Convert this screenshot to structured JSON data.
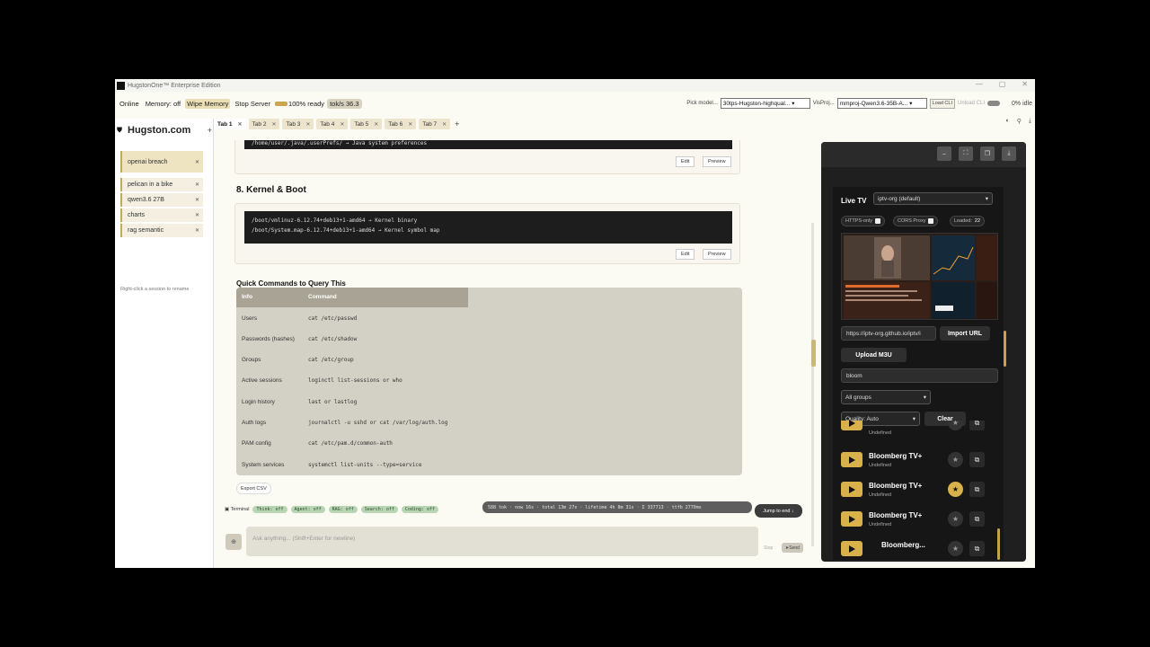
{
  "window": {
    "title": "HugstonOne™ Enterprise Edition",
    "controls": [
      "—",
      "▢",
      "✕"
    ]
  },
  "toolbar": {
    "online": "Online",
    "memory": "Memory: off",
    "wipe_memory": "Wipe Memory",
    "stop_server": "Stop Server",
    "ready": "100% ready",
    "toks": "tok/s 36.3",
    "pick_model_label": "Pick model...",
    "model_value": "30tps-Hugston-highqual...",
    "vis_proj_label": "VisProj...",
    "mmproj_value": "mmproj-Qwen3.6-35B-A...",
    "load_cli": "Load CLI",
    "unload_cli": "Unload CLI",
    "idle": "0% idle"
  },
  "tabs": [
    {
      "label": "Tab 1",
      "active": true
    },
    {
      "label": "Tab 2"
    },
    {
      "label": "Tab 3"
    },
    {
      "label": "Tab 4"
    },
    {
      "label": "Tab 5"
    },
    {
      "label": "Tab 6"
    },
    {
      "label": "Tab 7"
    }
  ],
  "sidebar": {
    "brand": "Hugston.com",
    "sessions": [
      {
        "label": "openai breach"
      },
      {
        "label": "pelican in a bike"
      },
      {
        "label": "qwen3.6 27B"
      },
      {
        "label": "charts"
      },
      {
        "label": "rag semantic"
      }
    ],
    "hint": "Right-click a session to rename"
  },
  "main": {
    "top_code": "/home/user/.java/.userPrefs/    →  Java system preferences",
    "edit": "Edit",
    "preview": "Preview",
    "section_title": "8. Kernel & Boot",
    "kernel_code": [
      "/boot/vmlinuz-6.12.74+deb13+1-amd64  → Kernel binary",
      "/boot/System.map-6.12.74+deb13+1-amd64 → Kernel symbol map"
    ],
    "quick_title": "Quick Commands to Query This",
    "table": {
      "headers": [
        "Info",
        "Command"
      ],
      "rows": [
        [
          "Users",
          "cat /etc/passwd"
        ],
        [
          "Passwords (hashes)",
          "cat /etc/shadow"
        ],
        [
          "Groups",
          "cat /etc/group"
        ],
        [
          "Active sessions",
          "loginctl list-sessions or who"
        ],
        [
          "Login history",
          "last or lastlog"
        ],
        [
          "Auth logs",
          "journalctl -u sshd or cat /var/log/auth.log"
        ],
        [
          "PAM config",
          "cat /etc/pam.d/common-auth"
        ],
        [
          "System services",
          "systemctl list-units --type=service"
        ]
      ]
    },
    "export_csv": "Export CSV"
  },
  "status": {
    "terminal": "Terminal",
    "chips": [
      "Think: off",
      "Agent: off",
      "RAG: off",
      "Search: off",
      "Coding: off"
    ],
    "stats": "588 tok · now 16s · total 13m 27s · lifetime 4h 8m 31s · Σ 337713 · ttfb 2770ms",
    "jump": "Jump to end ↓"
  },
  "composer": {
    "placeholder": "Ask anything... (Shift+Enter for newline)",
    "stop": "Stop",
    "send": "Send"
  },
  "panel": {
    "title": "Live TV",
    "source_select": "iptv-org (default)",
    "https_only": "HTTPS-only",
    "cors_proxy": "CORS Proxy",
    "loaded_label": "Loaded:",
    "loaded_count": "22",
    "url_value": "https://iptv-org.github.io/iptv/i",
    "import_url": "Import URL",
    "upload_m3u": "Upload M3U",
    "search_value": "bloom",
    "group_select": "All groups",
    "quality_select": "Quality: Auto",
    "clear": "Clear",
    "channels": [
      {
        "name": "",
        "group": "Undefined",
        "fav": false
      },
      {
        "name": "Bloomberg TV+",
        "group": "Undefined",
        "fav": false
      },
      {
        "name": "Bloomberg TV+",
        "group": "Undefined",
        "fav": true
      },
      {
        "name": "Bloomberg TV+",
        "group": "Undefined",
        "fav": false
      },
      {
        "name": "Bloomberg...",
        "group": "",
        "fav": false
      }
    ]
  },
  "colors": {
    "accent": "#d8b14a",
    "panel_bg": "#1f1f1f",
    "table_head": "#a8a394"
  }
}
